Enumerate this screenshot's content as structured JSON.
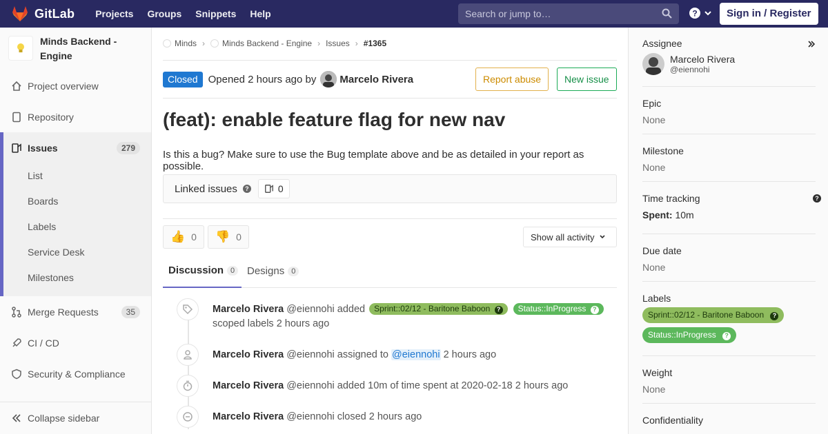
{
  "topbar": {
    "brand": "GitLab",
    "nav": [
      "Projects",
      "Groups",
      "Snippets",
      "Help"
    ],
    "search_placeholder": "Search or jump to…",
    "signin": "Sign in / Register",
    "bg_color": "#292961"
  },
  "sidebar": {
    "project_name": "Minds Backend - Engine",
    "items": [
      {
        "label": "Project overview",
        "icon": "home-icon"
      },
      {
        "label": "Repository",
        "icon": "doc-icon"
      },
      {
        "label": "Issues",
        "icon": "issues-icon",
        "count": "279"
      },
      {
        "label": "Merge Requests",
        "icon": "merge-icon",
        "count": "35"
      },
      {
        "label": "CI / CD",
        "icon": "rocket-icon"
      },
      {
        "label": "Security & Compliance",
        "icon": "shield-icon"
      }
    ],
    "issue_subitems": [
      "List",
      "Boards",
      "Labels",
      "Service Desk",
      "Milestones"
    ],
    "collapse": "Collapse sidebar",
    "accent": "#6666c4"
  },
  "breadcrumb": {
    "items": [
      "Minds",
      "Minds Backend - Engine",
      "Issues",
      "#1365"
    ]
  },
  "issue": {
    "status": "Closed",
    "opened_text": "Opened 2 hours ago by",
    "author": "Marcelo Rivera",
    "report_abuse": "Report abuse",
    "new_issue": "New issue",
    "title": "(feat): enable feature flag for new nav",
    "description": "Is this a bug? Make sure to use the Bug template above and be as detailed in your report as possible.",
    "linked_label": "Linked issues",
    "linked_count": "0",
    "thumbs_up": "0",
    "thumbs_down": "0",
    "activity_filter": "Show all activity"
  },
  "tabs": [
    {
      "label": "Discussion",
      "count": "0"
    },
    {
      "label": "Designs",
      "count": "0"
    }
  ],
  "events": [
    {
      "author": "Marcelo Rivera",
      "handle": "@eiennohi",
      "action": "added",
      "labels": [
        "Sprint::02/12 - Baritone Baboon",
        "Status::InProgress"
      ],
      "tail": "scoped labels 2 hours ago",
      "icon": "tag-icon"
    },
    {
      "author": "Marcelo Rivera",
      "handle": "@eiennohi",
      "action": "assigned to",
      "mention": "@eiennohi",
      "tail": "2 hours ago",
      "icon": "user-icon"
    },
    {
      "author": "Marcelo Rivera",
      "handle": "@eiennohi",
      "action": "added 10m of time spent at 2020-02-18 2 hours ago",
      "icon": "timer-icon"
    },
    {
      "author": "Marcelo Rivera",
      "handle": "@eiennohi",
      "action": "closed 2 hours ago",
      "icon": "closed-icon"
    }
  ],
  "right": {
    "assignee_title": "Assignee",
    "assignee_name": "Marcelo Rivera",
    "assignee_handle": "@eiennohi",
    "epic_title": "Epic",
    "epic_value": "None",
    "milestone_title": "Milestone",
    "milestone_value": "None",
    "time_title": "Time tracking",
    "spent_label": "Spent:",
    "spent_value": "10m",
    "due_title": "Due date",
    "due_value": "None",
    "labels_title": "Labels",
    "labels": [
      "Sprint::02/12 - Baritone Baboon",
      "Status::InProgress"
    ],
    "weight_title": "Weight",
    "weight_value": "None",
    "confidentiality_title": "Confidentiality"
  }
}
